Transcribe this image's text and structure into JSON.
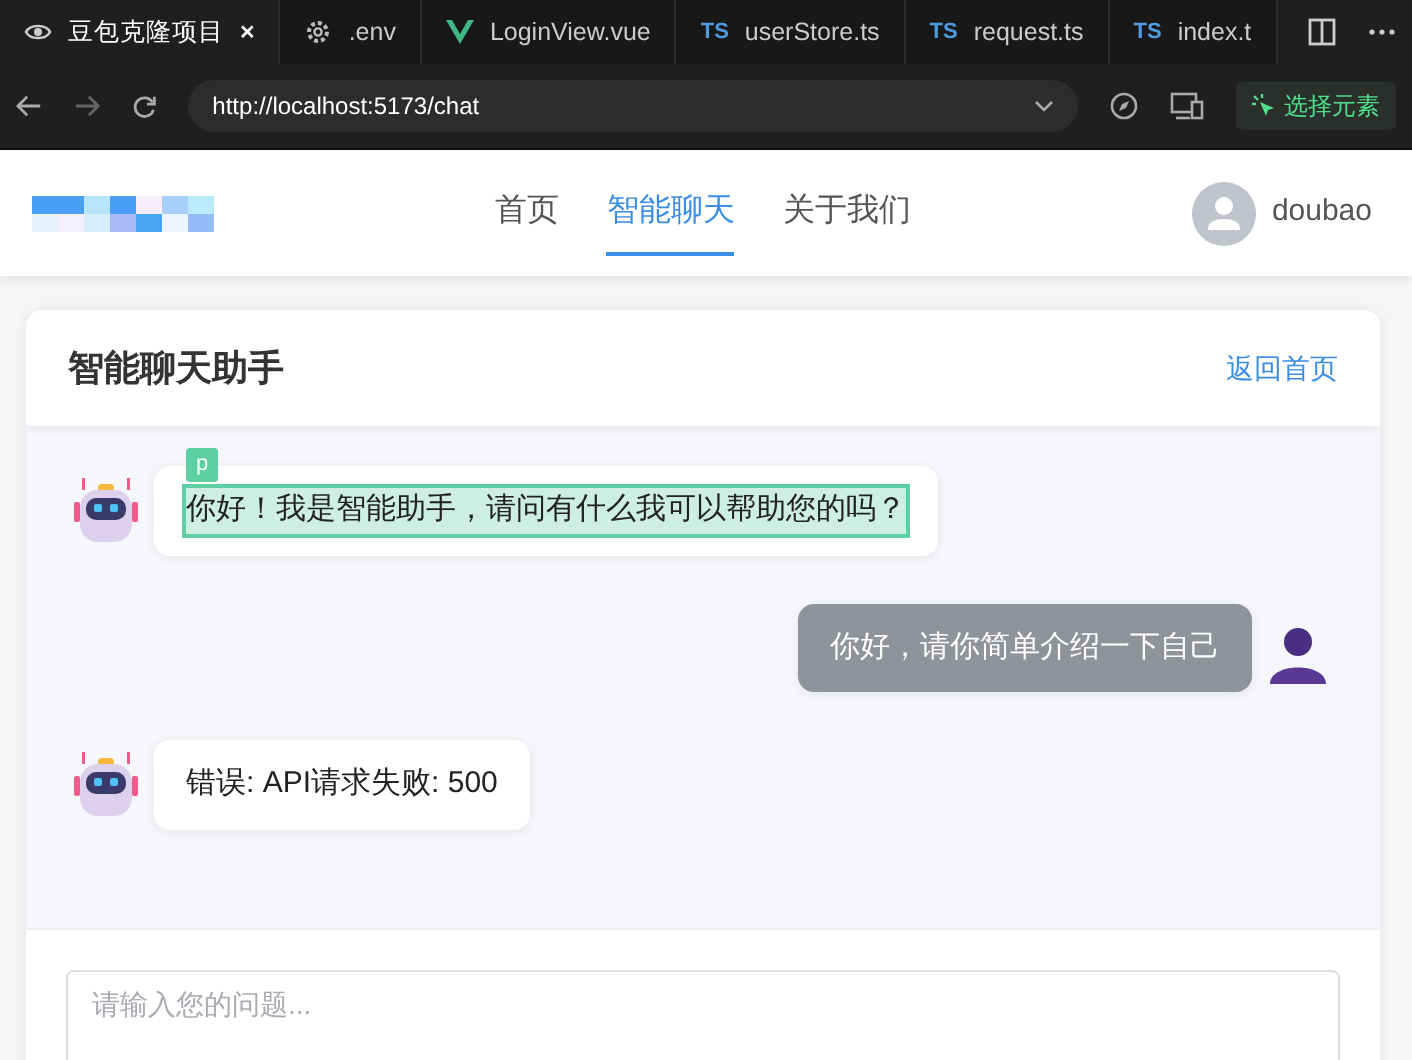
{
  "browser": {
    "tabs": [
      {
        "label": "豆包克隆项目",
        "kind": "page",
        "selected": true,
        "close": "×"
      },
      {
        "label": ".env",
        "kind": "gear",
        "selected": false
      },
      {
        "label": "LoginView.vue",
        "kind": "vue",
        "selected": false
      },
      {
        "label": "userStore.ts",
        "kind": "ts",
        "badge": "TS",
        "selected": false
      },
      {
        "label": "request.ts",
        "kind": "ts",
        "badge": "TS",
        "selected": false
      },
      {
        "label": "index.t",
        "kind": "ts",
        "badge": "TS",
        "selected": false
      }
    ],
    "url": "http://localhost:5173/chat",
    "inspect_button": "选择元素"
  },
  "navbar": {
    "links": [
      {
        "label": "首页",
        "selected": false
      },
      {
        "label": "智能聊天",
        "selected": true
      },
      {
        "label": "关于我们",
        "selected": false
      }
    ],
    "username": "doubao"
  },
  "chat": {
    "title": "智能聊天助手",
    "back_link": "返回首页",
    "messages": [
      {
        "kind": "assistant",
        "text": "你好！我是智能助手，请问有什么我可以帮助您的吗？",
        "inspected": true,
        "inspect_tag": "p"
      },
      {
        "kind": "user",
        "text": "你好，请你简单介绍一下自己",
        "inspected": false
      },
      {
        "kind": "assistant",
        "text": "错误: API请求失败: 500",
        "inspected": false
      }
    ],
    "input": {
      "placeholder": "请输入您的问题..."
    }
  }
}
